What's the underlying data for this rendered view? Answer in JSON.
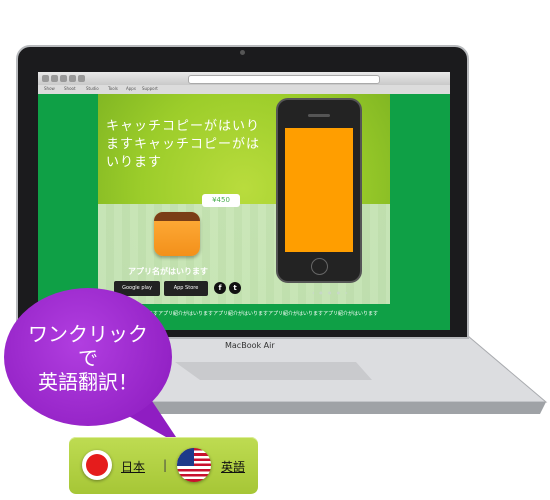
{
  "browser": {
    "tabs": [
      "Show",
      "Shoot",
      "Studio",
      "Tools",
      "Apps",
      "Support"
    ]
  },
  "site": {
    "catchcopy": "キャッチコピーがはいりますキャッチコピーがはいります",
    "price": "¥450",
    "app_name": "アプリ名がはいります",
    "google_play_label": "Google play",
    "app_store_label": "App Store",
    "facebook_icon_glyph": "f",
    "twitter_icon_glyph": "t",
    "ticker": "ますアプリ紹介がはいりますアプリ紹介がはいりますアプリ紹介がはいりますアプリ紹介がはいりますアプリ紹介がはいりますアプリ紹介がはいります",
    "screen_color": "#ff9e00",
    "bg_green": "#0fa046"
  },
  "device": {
    "label": "MacBook Air"
  },
  "bubble": {
    "line1": "ワンクリック",
    "line2": "で",
    "line3": "英語翻訳！",
    "color": "#9b27cf"
  },
  "language": {
    "japanese_label": "日本",
    "separator": "|",
    "english_label": "英語"
  }
}
